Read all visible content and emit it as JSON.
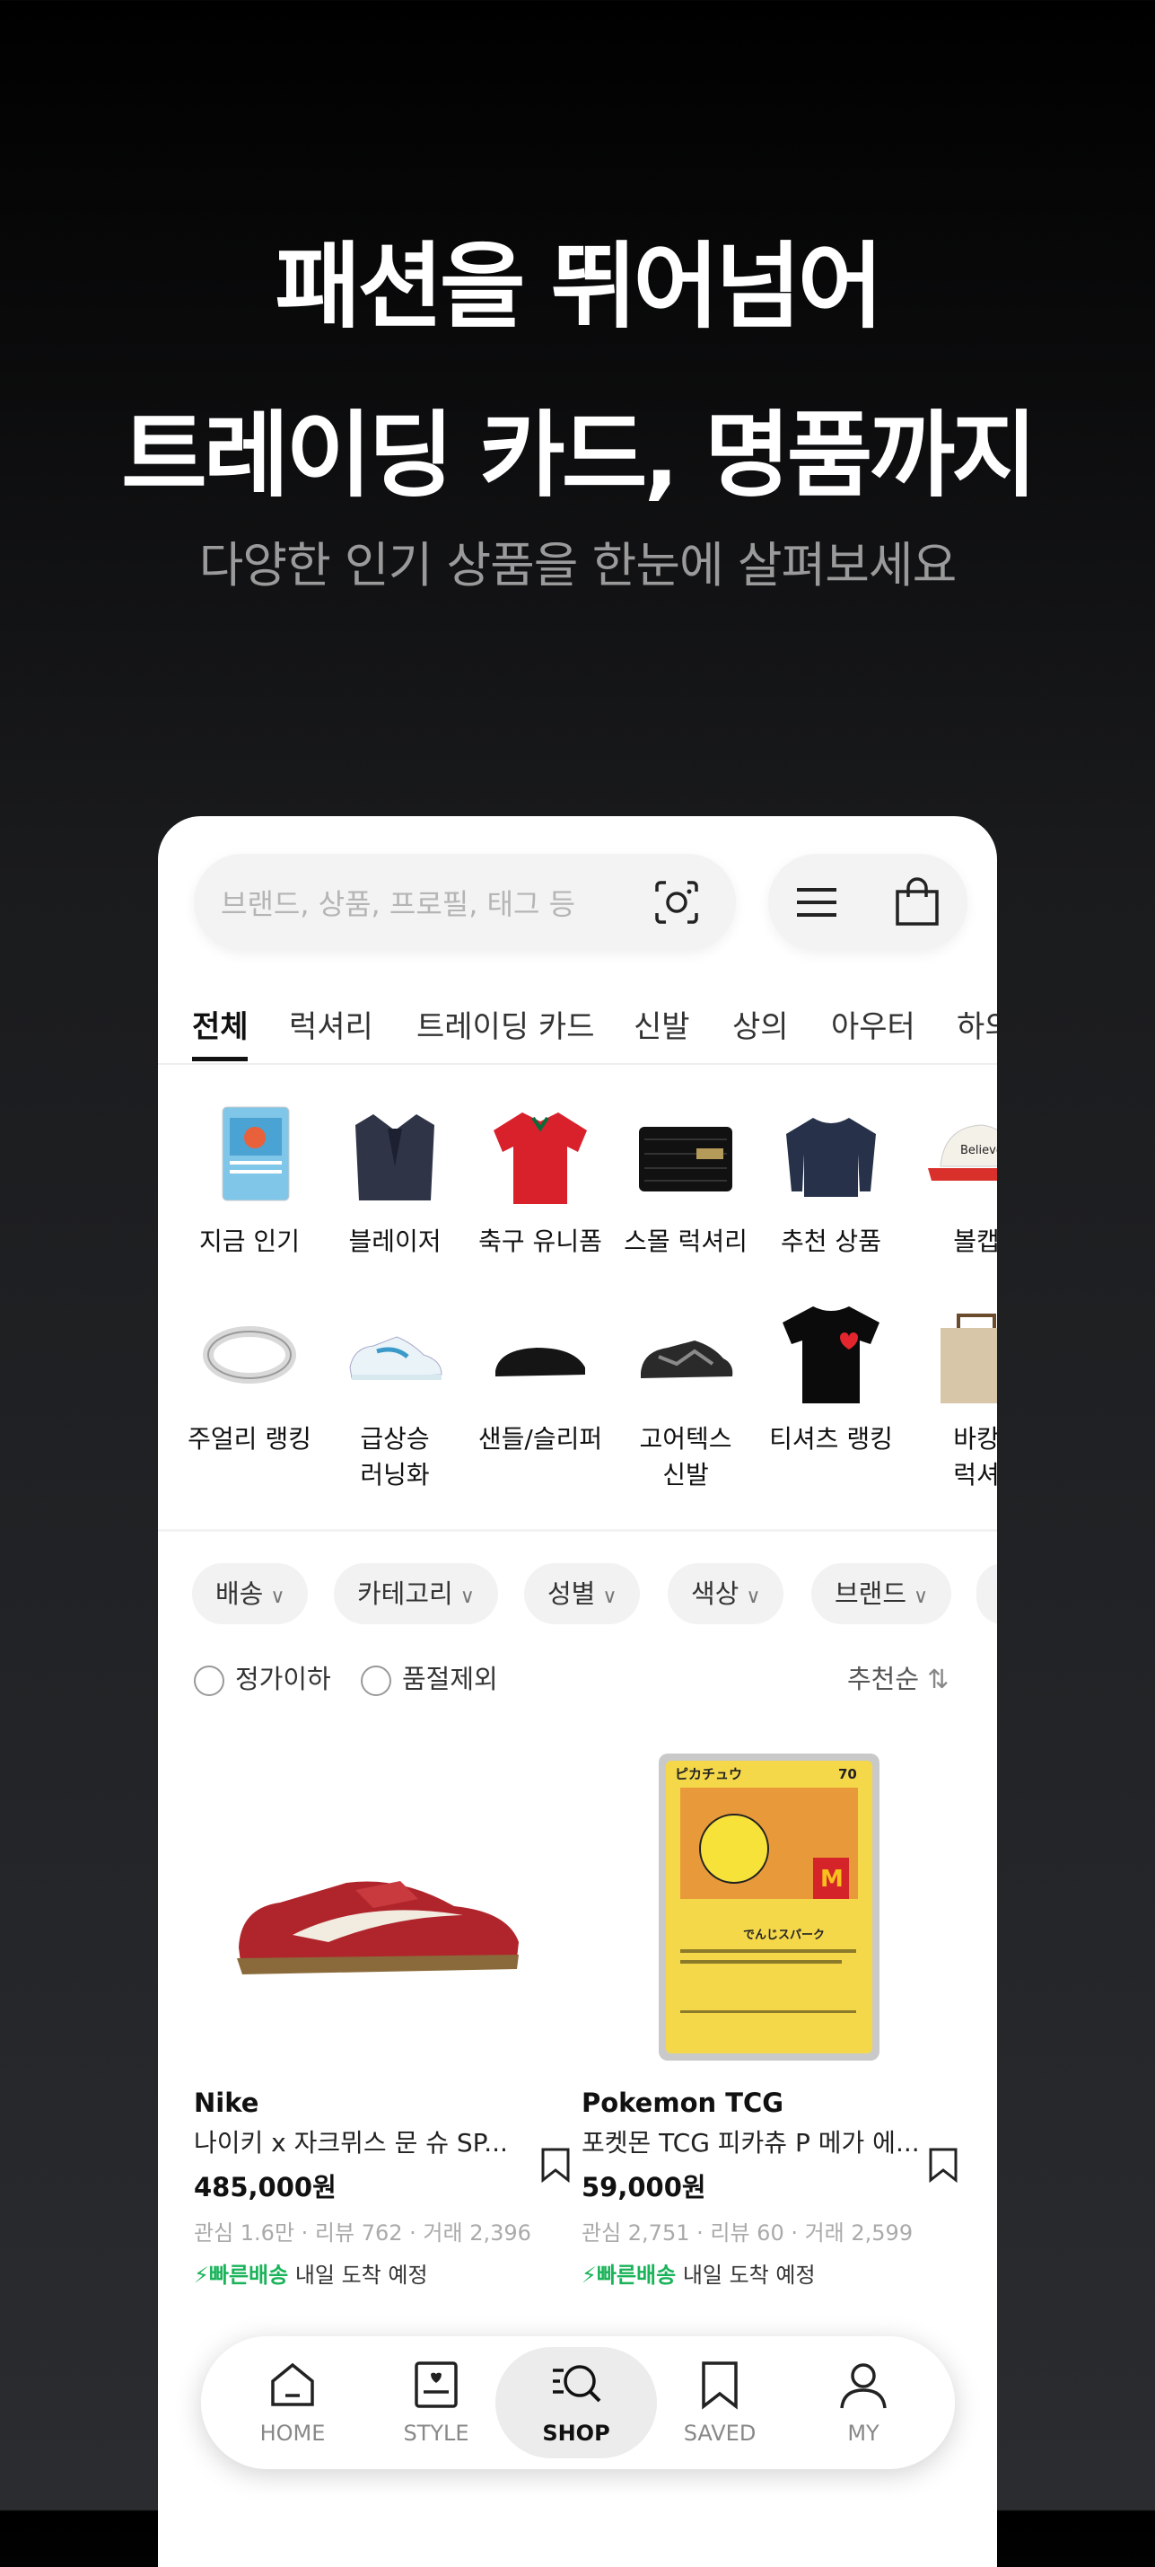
{
  "headline": {
    "line1": "패션을 뛰어넘어",
    "line2": "트레이딩 카드, 명품까지"
  },
  "subtitle": "다양한 인기 상품을 한눈에 살펴보세요",
  "search": {
    "placeholder": "브랜드, 상품, 프로필, 태그 등"
  },
  "tabs": [
    "전체",
    "럭셔리",
    "트레이딩 카드",
    "신발",
    "상의",
    "아우터",
    "하의"
  ],
  "categories": [
    {
      "label": "지금 인기",
      "icon": "pokemon-card-icon"
    },
    {
      "label": "블레이저",
      "icon": "blazer-icon"
    },
    {
      "label": "축구 유니폼",
      "icon": "jersey-icon"
    },
    {
      "label": "스몰 럭셔리",
      "icon": "wallet-icon"
    },
    {
      "label": "추천 상품",
      "icon": "sweater-icon"
    },
    {
      "label": "볼캡",
      "icon": "cap-icon"
    },
    {
      "label": "주얼리 랭킹",
      "icon": "ring-icon"
    },
    {
      "label": "급상승",
      "label2": "러닝화",
      "icon": "running-shoe-icon"
    },
    {
      "label": "샌들/슬리퍼",
      "icon": "slipper-icon"
    },
    {
      "label": "고어텍스",
      "label2": "신발",
      "icon": "gore-tex-shoe-icon"
    },
    {
      "label": "티셔츠 랭킹",
      "icon": "tshirt-icon"
    },
    {
      "label": "바캉",
      "label2": "럭셔",
      "icon": "bag-icon"
    }
  ],
  "filters": [
    "배송",
    "카테고리",
    "성별",
    "색상",
    "브랜드"
  ],
  "toggles": [
    "정가이하",
    "품절제외"
  ],
  "sort_label": "추천순",
  "products": [
    {
      "brand": "Nike",
      "name": "나이키 x 자크뮈스 문 슈 SP...",
      "price": "485,000원",
      "stats": "관심 1.6만 · 리뷰 762 · 거래 2,396",
      "fast": "빠른배송",
      "ship": " 내일 도착 예정"
    },
    {
      "brand": "Pokemon TCG",
      "name": "포켓몬 TCG 피카츄 P 메가 에...",
      "price": "59,000원",
      "stats": "관심 2,751 · 리뷰 60 · 거래 2,599",
      "fast": "빠른배송",
      "ship": " 내일 도착 예정",
      "card": {
        "name": "ピカチュウ",
        "hp": "70",
        "move": "でんじスパーク"
      }
    }
  ],
  "nav": [
    "HOME",
    "STYLE",
    "SHOP",
    "SAVED",
    "MY"
  ],
  "nav_active": "SHOP",
  "colors": {
    "fast_delivery": "#1ab35a",
    "background_top": "#000000",
    "background_bottom": "#2a2c30"
  }
}
